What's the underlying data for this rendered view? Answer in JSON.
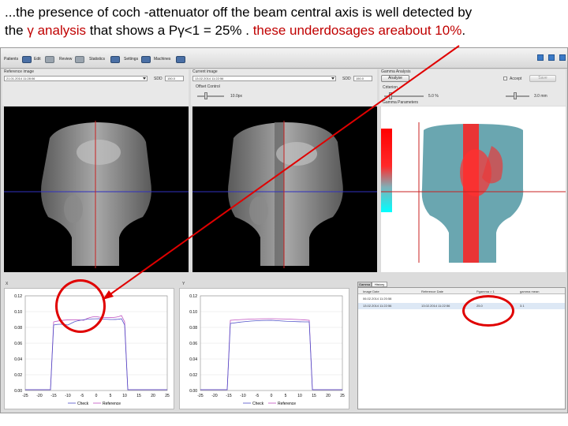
{
  "caption": {
    "line1": "...the presence of coch -attenuator off the beam central axis  is well detected by",
    "the": "the ",
    "gamma_analysis": "γ analysis",
    "mid": " that shows a P",
    "gamma": "γ",
    "cond": "<1 = 25% . ",
    "under": "these underdosages areabout 10%",
    "end": "."
  },
  "toolbar": {
    "items": [
      "Patients",
      "Edit",
      "Review",
      "Statistics",
      "Settings",
      "Machines"
    ]
  },
  "reference": {
    "section_label": "Reference image",
    "date_value": "21.01.2014 11:28:06",
    "sdd_label": "SDD",
    "sdd_value": "150.0"
  },
  "current": {
    "section_label": "Current image",
    "date_value": "13.02.2014 11:22:56",
    "sdd_label": "SDD",
    "sdd_value": "150.0",
    "offset_label": "Offset Control",
    "offset_value": "10.0px"
  },
  "gamma": {
    "section_label": "Gamma Analysis",
    "analyze_button": "Analyse",
    "accept_label": "Accept",
    "save_button": "Save",
    "criterion_label": "Criterion",
    "criterion_value": "5.0 %",
    "dta_value": "3.0 mm",
    "params_label": "Gamma Parameters"
  },
  "profiles": {
    "left": {
      "label": "X",
      "yticks": [
        "0.12",
        "0.10",
        "0.08",
        "0.06",
        "0.04",
        "0.02",
        "0.00"
      ],
      "xticks": [
        "-25",
        "-20",
        "-15",
        "-10",
        "-5",
        "0",
        "5",
        "10",
        "15",
        "20",
        "25"
      ],
      "legend_check": "Check",
      "legend_reference": "Reference"
    },
    "right": {
      "label": "Y",
      "yticks": [
        "0.12",
        "0.10",
        "0.08",
        "0.06",
        "0.04",
        "0.02",
        "0.00"
      ],
      "xticks": [
        "-25",
        "-20",
        "-15",
        "-10",
        "-5",
        "0",
        "5",
        "10",
        "15",
        "20",
        "25"
      ],
      "legend_check": "Check",
      "legend_reference": "Reference"
    }
  },
  "history": {
    "tabs": [
      "Gamma",
      "History"
    ],
    "columns": [
      "Image Date",
      "Reference Date",
      "Pgamma > 1",
      "gamma mean"
    ],
    "rows": [
      [
        "06.02.2014 11:20:58",
        "",
        "",
        ""
      ],
      [
        "13.02.2014 11:22:56",
        "13.02.2014 11:22:56",
        "25.0",
        "3.1"
      ]
    ]
  },
  "colors": {
    "accent_red": "#e00000",
    "caption_red": "#c00000",
    "crosshair_red": "#c82020",
    "crosshair_blue": "#3030c0",
    "check_line": "#5050c8",
    "reference_line": "#c050c0"
  }
}
